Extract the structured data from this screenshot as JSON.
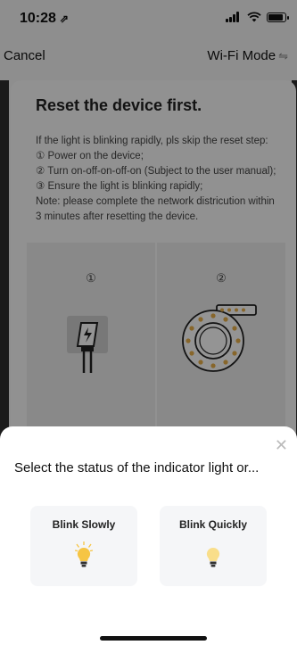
{
  "status_bar": {
    "time": "10:28",
    "location_arrow": "⇗"
  },
  "nav": {
    "cancel_label": "Cancel",
    "mode_label": "Wi-Fi Mode",
    "mode_icon": "⇋"
  },
  "card": {
    "title": "Reset the device first.",
    "lines": [
      "If the light is blinking rapidly, pls skip the reset step:",
      "① Power on the device;",
      "② Turn on-off-on-off-on (Subject to the user manual);",
      "③ Ensure the light is blinking rapidly;",
      "Note: please complete the network districution within",
      "3 minutes after resetting the device."
    ],
    "steps": [
      {
        "num": "①"
      },
      {
        "num": "②"
      }
    ]
  },
  "sheet": {
    "close_icon": "✕",
    "title": "Select the status of the indicator light or...",
    "options": [
      {
        "label": "Blink Slowly",
        "icon": "bulb-blinking-icon"
      },
      {
        "label": "Blink Quickly",
        "icon": "bulb-dim-icon"
      }
    ]
  },
  "colors": {
    "bulb_on": "#f6c544",
    "bulb_dim": "#f9de8a",
    "ring_dots": "#e8b04a"
  }
}
